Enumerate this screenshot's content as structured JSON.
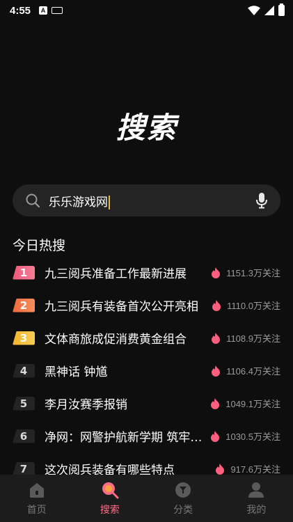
{
  "status_bar": {
    "time": "4:55",
    "notification_a": "A"
  },
  "page": {
    "title": "搜索"
  },
  "search": {
    "value": "乐乐游戏网"
  },
  "hot": {
    "section_title": "今日热搜",
    "items": [
      {
        "rank": "1",
        "title": "九三阅兵准备工作最新进展",
        "follow": "1151.3万关注"
      },
      {
        "rank": "2",
        "title": "九三阅兵有装备首次公开亮相",
        "follow": "1110.0万关注"
      },
      {
        "rank": "3",
        "title": "文体商旅成促消费黄金组合",
        "follow": "1108.9万关注"
      },
      {
        "rank": "4",
        "title": "黑神话 钟馗",
        "follow": "1106.4万关注"
      },
      {
        "rank": "5",
        "title": "李月汝赛季报销",
        "follow": "1049.1万关注"
      },
      {
        "rank": "6",
        "title": "净网：网警护航新学期 筑牢防线",
        "follow": "1030.5万关注"
      },
      {
        "rank": "7",
        "title": "这次阅兵装备有哪些特点",
        "follow": "917.6万关注"
      }
    ]
  },
  "nav": {
    "home": "首页",
    "search": "搜索",
    "category": "分类",
    "mine": "我的"
  },
  "colors": {
    "accent": "#ff6c86",
    "background": "#0e0e0e",
    "caret": "#e6b84a"
  }
}
